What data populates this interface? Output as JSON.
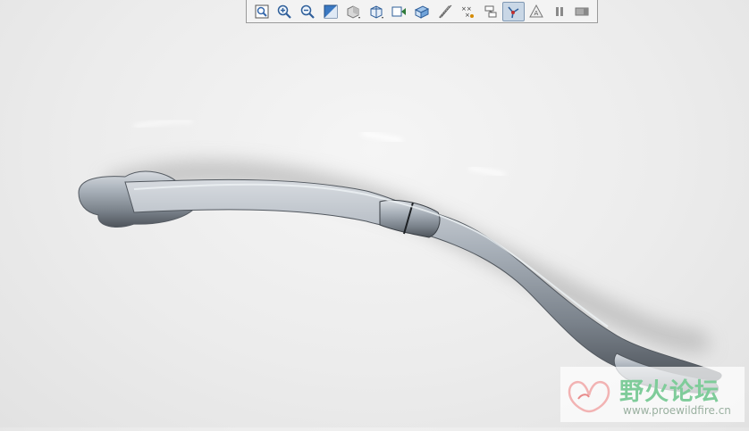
{
  "toolbar": {
    "buttons": [
      {
        "name": "refit-icon",
        "active": false
      },
      {
        "name": "zoom-in-icon",
        "active": false
      },
      {
        "name": "zoom-out-icon",
        "active": false
      },
      {
        "name": "repaint-icon",
        "active": false
      },
      {
        "name": "display-style-icon",
        "active": false
      },
      {
        "name": "saved-orientations-icon",
        "active": false
      },
      {
        "name": "view-manager-icon",
        "active": false
      },
      {
        "name": "datum-planes-icon",
        "active": false
      },
      {
        "name": "datum-axes-icon",
        "active": false
      },
      {
        "name": "point-display-icon",
        "active": false
      },
      {
        "name": "csys-display-icon",
        "active": false
      },
      {
        "name": "spin-center-icon",
        "active": true
      },
      {
        "name": "annotation-display-icon",
        "active": false
      },
      {
        "name": "pause-icon",
        "active": false
      },
      {
        "name": "regenerate-icon",
        "active": false
      }
    ]
  },
  "watermark": {
    "title": "野火论坛",
    "url": "www.proewildfire.cn"
  },
  "colors": {
    "background": "#ececec",
    "metal_mid": "#9aa3ad",
    "metal_dark": "#5c636c",
    "watermark_green": "#7fcc9a"
  }
}
